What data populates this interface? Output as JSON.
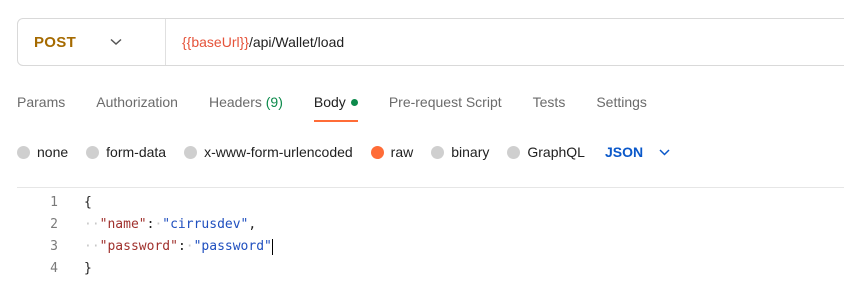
{
  "request": {
    "method": "POST",
    "url_var": "{{baseUrl}}",
    "url_path": "/api/Wallet/load"
  },
  "tabs": [
    {
      "label": "Params"
    },
    {
      "label": "Authorization"
    },
    {
      "label": "Headers",
      "count": "(9)"
    },
    {
      "label": "Body"
    },
    {
      "label": "Pre-request Script"
    },
    {
      "label": "Tests"
    },
    {
      "label": "Settings"
    }
  ],
  "body_options": [
    {
      "label": "none",
      "selected": false
    },
    {
      "label": "form-data",
      "selected": false
    },
    {
      "label": "x-www-form-urlencoded",
      "selected": false
    },
    {
      "label": "raw",
      "selected": true
    },
    {
      "label": "binary",
      "selected": false
    },
    {
      "label": "GraphQL",
      "selected": false
    }
  ],
  "language": "JSON",
  "editor": {
    "line_numbers": [
      "1",
      "2",
      "3",
      "4"
    ],
    "open_brace": "{",
    "close_brace": "}",
    "line2_key": "\"name\"",
    "line2_value": "\"cirrusdev\"",
    "line3_key": "\"password\"",
    "line3_value": "\"password\""
  },
  "colors": {
    "method": "#a56a00",
    "variable": "#e5533a",
    "active_tab_underline": "#ff6c37",
    "radio_selected": "#ff6c37",
    "language": "#0a58ca",
    "json_key": "#a0312d",
    "json_string": "#1f4fbf"
  }
}
